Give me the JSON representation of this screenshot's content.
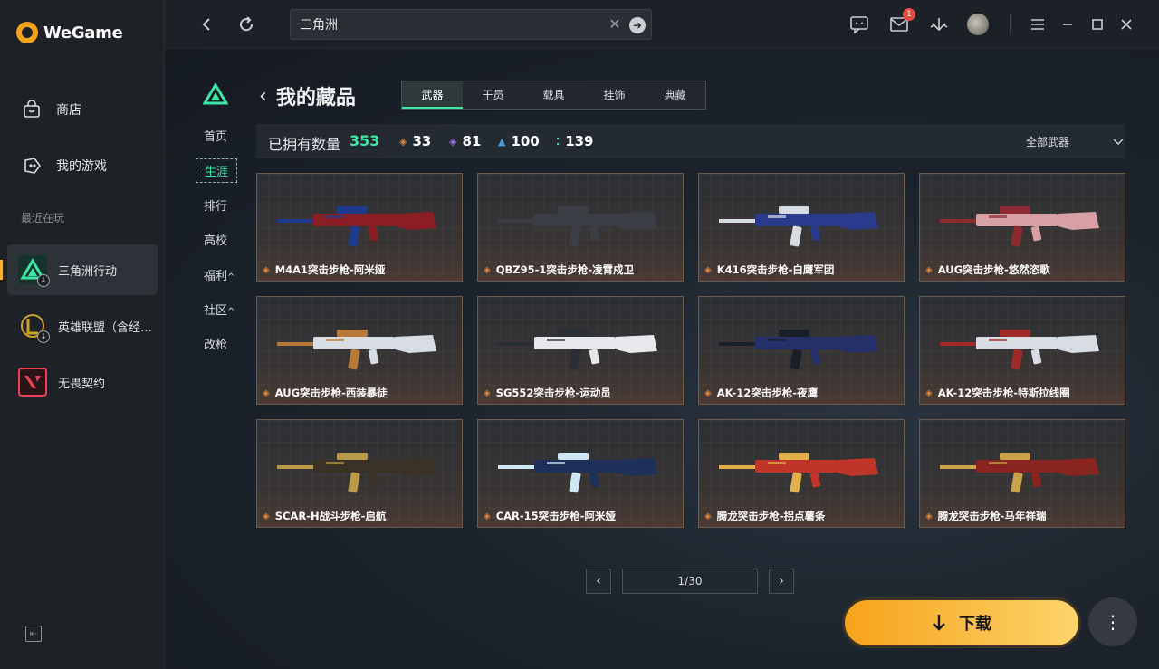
{
  "app": {
    "name": "WeGame"
  },
  "sidebar": {
    "nav": [
      {
        "label": "商店",
        "icon": "store-bag-icon"
      },
      {
        "label": "我的游戏",
        "icon": "gamepad-icon"
      }
    ],
    "recent_title": "最近在玩",
    "recent": [
      {
        "label": "三角洲行动",
        "icon": "delta-force-icon",
        "color": "#1a8f6b"
      },
      {
        "label": "英雄联盟（含经…",
        "icon": "league-of-legends-icon",
        "color": "#c9a227"
      },
      {
        "label": "无畏契约",
        "icon": "valorant-icon",
        "color": "#e84057"
      }
    ]
  },
  "topbar": {
    "search_value": "三角洲",
    "mail_count": "1",
    "icons": [
      "back-icon",
      "refresh-icon",
      "chat-icon",
      "mail-icon",
      "download-manager-icon",
      "menu-icon",
      "maximize-icon",
      "close-icon"
    ]
  },
  "subnav": {
    "items": [
      {
        "label": "首页",
        "active": false
      },
      {
        "label": "生涯",
        "active": true
      },
      {
        "label": "排行",
        "active": false
      },
      {
        "label": "高校",
        "active": false
      },
      {
        "label": "福利",
        "active": false,
        "caret": "^"
      },
      {
        "label": "社区",
        "active": false,
        "caret": "^"
      },
      {
        "label": "改枪",
        "active": false
      }
    ]
  },
  "page": {
    "title": "我的藏品",
    "tabs": [
      "武器",
      "干员",
      "载具",
      "挂饰",
      "典藏"
    ],
    "active_tab": "武器"
  },
  "stats": {
    "owned_label": "已拥有数量",
    "owned_value": "353",
    "rarities": [
      {
        "value": "33",
        "color": "#e08a3c"
      },
      {
        "value": "81",
        "color": "#9a6be0"
      },
      {
        "value": "100",
        "color": "#4a9be0"
      },
      {
        "value": "139",
        "color": "#3ee6a4"
      }
    ],
    "filter_label": "全部武器"
  },
  "items": [
    {
      "name": "M4A1突击步枪-阿米娅",
      "body": "#8a1e24",
      "accent": "#1e3a8a"
    },
    {
      "name": "QBZ95-1突击步枪-凌霄戍卫",
      "body": "#3b3f45",
      "accent": "#3b3f45"
    },
    {
      "name": "K416突击步枪-白鹰军团",
      "body": "#2a3a8c",
      "accent": "#d8dde3"
    },
    {
      "name": "AUG突击步枪-悠然恣歌",
      "body": "#d7a0a4",
      "accent": "#8c2a32"
    },
    {
      "name": "AUG突击步枪-西装暴徒",
      "body": "#d8dde3",
      "accent": "#b87a3a"
    },
    {
      "name": "SG552突击步枪-运动员",
      "body": "#e6e8eb",
      "accent": "#2a2e35"
    },
    {
      "name": "AK-12突击步枪-夜鹰",
      "body": "#25306a",
      "accent": "#1b1f2a"
    },
    {
      "name": "AK-12突击步枪-特斯拉线圈",
      "body": "#d8dde3",
      "accent": "#a02a2a"
    },
    {
      "name": "SCAR-H战斗步枪-启航",
      "body": "#3a3226",
      "accent": "#b89a4a"
    },
    {
      "name": "CAR-15突击步枪-阿米娅",
      "body": "#1e2f5a",
      "accent": "#cfe6f5"
    },
    {
      "name": "腾龙突击步枪-拐点薯条",
      "body": "#c0352a",
      "accent": "#e0b04a"
    },
    {
      "name": "腾龙突击步枪-马年祥瑞",
      "body": "#8a2420",
      "accent": "#c9a24a"
    }
  ],
  "pagination": {
    "current": "1/30"
  },
  "actions": {
    "download_label": "下载",
    "more_label": "⋮"
  }
}
